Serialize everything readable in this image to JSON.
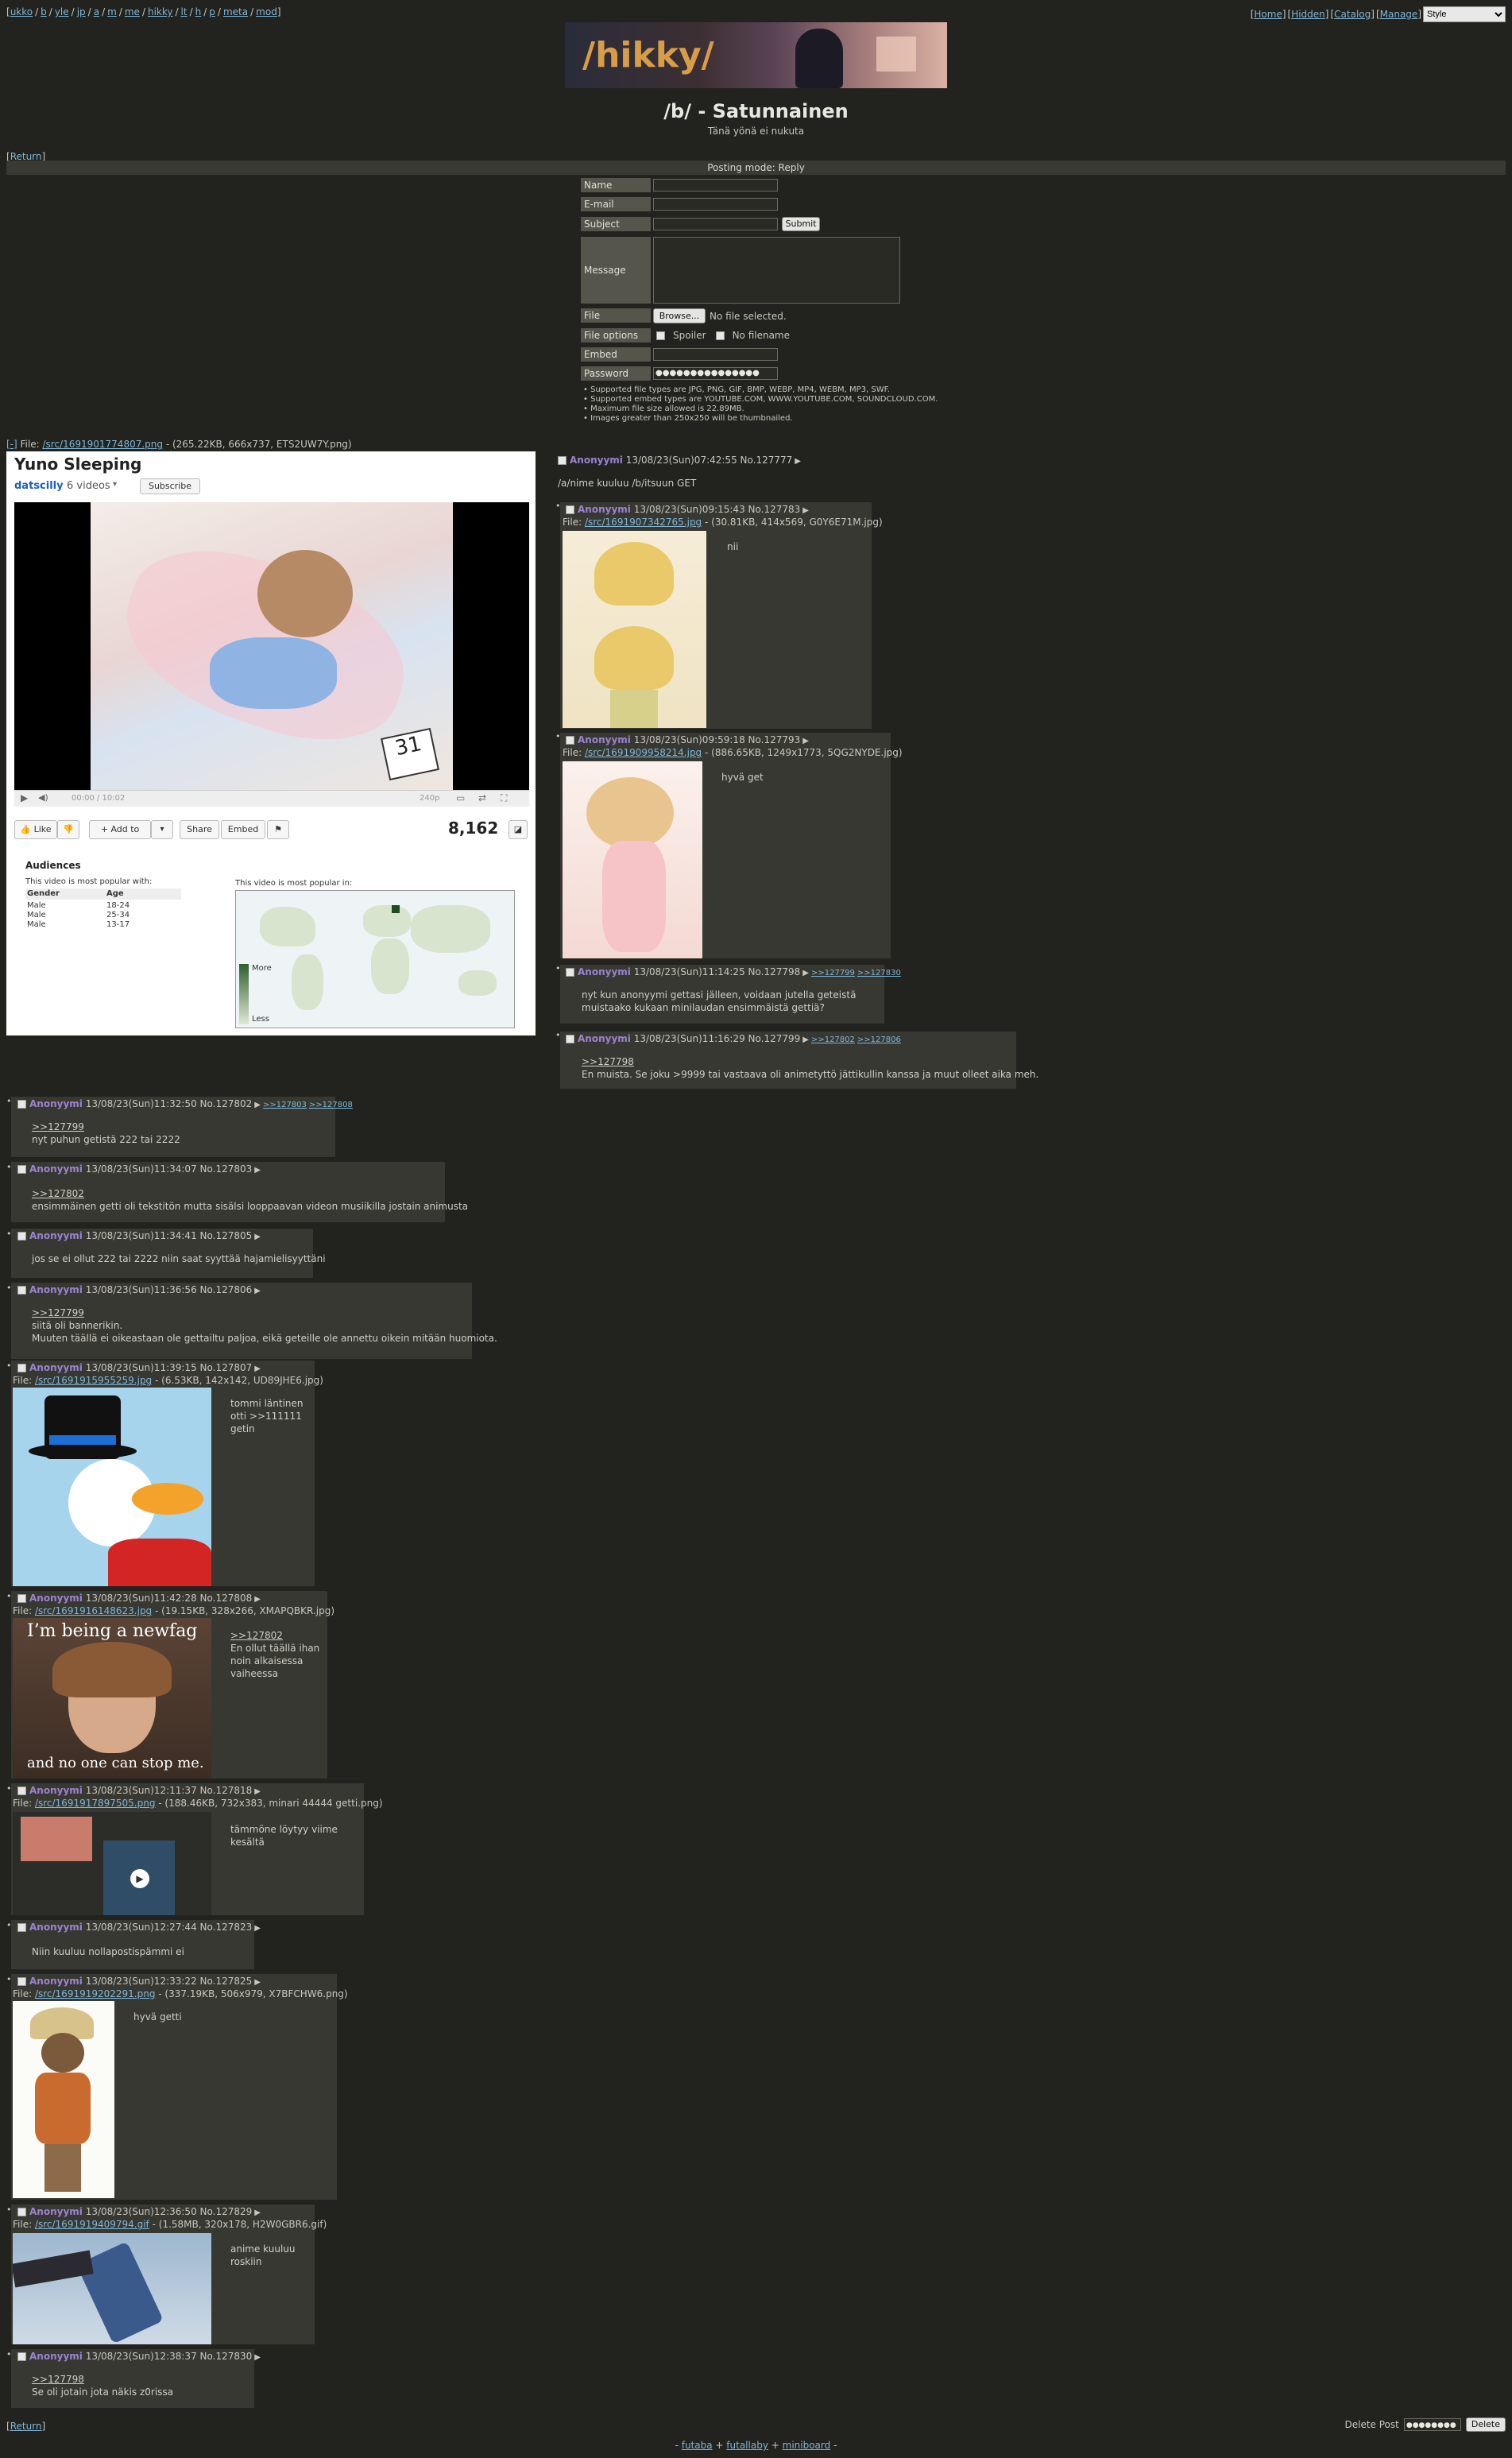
{
  "nav": {
    "boards": [
      "ukko",
      "b",
      "yle",
      "jp",
      "a",
      "m",
      "me",
      "hikky",
      "lt",
      "h",
      "p",
      "meta",
      "mod"
    ],
    "right_links": [
      "Home",
      "Hidden",
      "Catalog",
      "Manage"
    ],
    "style_select": "Style"
  },
  "banner": {
    "logo_text": "/hikky/"
  },
  "board": {
    "title": "/b/ - Satunnainen",
    "subtitle": "Tänä yönä ei nukuta"
  },
  "return_label": "Return",
  "posting_mode": "Posting mode: Reply",
  "form": {
    "name_label": "Name",
    "email_label": "E-mail",
    "subject_label": "Subject",
    "submit_label": "Submit",
    "message_label": "Message",
    "file_label": "File",
    "browse_label": "Browse...",
    "no_file": "No file selected.",
    "file_options_label": "File options",
    "spoiler_label": "Spoiler",
    "no_filename_label": "No filename",
    "embed_label": "Embed",
    "password_label": "Password",
    "password_value": "●●●●●●●●●●●●●●●"
  },
  "rules": [
    "Supported file types are JPG, PNG, GIF, BMP, WEBP, MP4, WEBM, MP3, SWF.",
    "Supported embed types are YOUTUBE.COM, WWW.YOUTUBE.COM, SOUNDCLOUD.COM.",
    "Maximum file size allowed is 22.89MB.",
    "Images greater than 250x250 will be thumbnailed."
  ],
  "op": {
    "collapse": "[-]",
    "file_prefix": "File:",
    "file_link": "/src/1691901774807.png",
    "file_meta": "- (265.22KB, 666x737, ETS2UW7Y.png)",
    "name": "Anonyymi",
    "date": "13/08/23(Sun)07:42:55",
    "no": "No.127777",
    "text": "/a/nime kuuluu /b/itsuun GET",
    "embed": {
      "title": "Yuno Sleeping",
      "channel": "datscilly",
      "videos": "6 videos",
      "subscribe": "Subscribe",
      "time": "00:00 / 10:02",
      "quality": "240p",
      "like": "Like",
      "add_to": "Add to",
      "share": "Share",
      "embed": "Embed",
      "views": "8,162",
      "audiences": "Audiences",
      "popular_with": "This video is most popular with:",
      "popular_in": "This video is most popular in:",
      "col_gender": "Gender",
      "col_age": "Age",
      "rows": [
        [
          "Male",
          "18-24"
        ],
        [
          "Male",
          "25-34"
        ],
        [
          "Male",
          "13-17"
        ]
      ],
      "legend_more": "More",
      "legend_less": "Less"
    }
  },
  "replies_right": [
    {
      "name": "Anonyymi",
      "date": "13/08/23(Sun)09:15:43",
      "no": "No.127783",
      "file_link": "/src/1691907342765.jpg",
      "file_meta": "- (30.81KB, 414x569, G0Y6E71M.jpg)",
      "text": "nii"
    },
    {
      "name": "Anonyymi",
      "date": "13/08/23(Sun)09:59:18",
      "no": "No.127793",
      "file_link": "/src/1691909958214.jpg",
      "file_meta": "- (886.65KB, 1249x1773, 5QG2NYDE.jpg)",
      "text": "hyvä get"
    },
    {
      "name": "Anonyymi",
      "date": "13/08/23(Sun)11:14:25",
      "no": "No.127798",
      "backlinks": [
        ">>127799",
        ">>127830"
      ],
      "text1": "nyt kun anonyymi gettasi jälleen, voidaan jutella geteistä",
      "text2": "muistaako kukaan minilaudan ensimmäistä gettiä?"
    },
    {
      "name": "Anonyymi",
      "date": "13/08/23(Sun)11:16:29",
      "no": "No.127799",
      "backlinks": [
        ">>127802",
        ">>127806"
      ],
      "quote": ">>127798",
      "text": "En muista. Se joku >9999 tai vastaava oli animetyttö jättikullin kanssa ja muut olleet aika meh."
    }
  ],
  "replies": [
    {
      "name": "Anonyymi",
      "date": "13/08/23(Sun)11:32:50",
      "no": "No.127802",
      "backlinks": [
        ">>127803",
        ">>127808"
      ],
      "quote": ">>127799",
      "text": "nyt puhun getistä 222 tai 2222"
    },
    {
      "name": "Anonyymi",
      "date": "13/08/23(Sun)11:34:07",
      "no": "No.127803",
      "quote": ">>127802",
      "text": "ensimmäinen getti oli tekstitön mutta sisälsi looppaavan videon musiikilla jostain animusta"
    },
    {
      "name": "Anonyymi",
      "date": "13/08/23(Sun)11:34:41",
      "no": "No.127805",
      "text": "jos se ei ollut 222 tai 2222 niin saat syyttää hajamielisyyttäni"
    },
    {
      "name": "Anonyymi",
      "date": "13/08/23(Sun)11:36:56",
      "no": "No.127806",
      "quote": ">>127799",
      "text1": "siitä oli bannerikin.",
      "text2": "Muuten täällä ei oikeastaan ole gettailtu paljoa, eikä geteille ole annettu oikein mitään huomiota."
    },
    {
      "name": "Anonyymi",
      "date": "13/08/23(Sun)11:39:15",
      "no": "No.127807",
      "file_link": "/src/1691915955259.jpg",
      "file_meta": "- (6.53KB, 142x142, UD89JHE6.jpg)",
      "text1": "tommi läntinen",
      "text2": "otti >>111111",
      "text3": "getin"
    },
    {
      "name": "Anonyymi",
      "date": "13/08/23(Sun)11:42:28",
      "no": "No.127808",
      "file_link": "/src/1691916148623.jpg",
      "file_meta": "- (19.15KB, 328x266, XMAPQBKR.jpg)",
      "quote": ">>127802",
      "text1": "En ollut täällä ihan",
      "text2": "noin alkaisessa",
      "text3": "vaiheessa",
      "img_top": "I’m being a newfag",
      "img_bottom": "and no one can stop me."
    },
    {
      "name": "Anonyymi",
      "date": "13/08/23(Sun)12:11:37",
      "no": "No.127818",
      "file_link": "/src/1691917897505.png",
      "file_meta": "- (188.46KB, 732x383, minari 44444 getti.png)",
      "text1": "tämmöne löytyy viime",
      "text2": "kesältä"
    },
    {
      "name": "Anonyymi",
      "date": "13/08/23(Sun)12:27:44",
      "no": "No.127823",
      "text": "Niin kuuluu nollapostispämmi ei"
    },
    {
      "name": "Anonyymi",
      "date": "13/08/23(Sun)12:33:22",
      "no": "No.127825",
      "file_link": "/src/1691919202291.png",
      "file_meta": "- (337.19KB, 506x979, X7BFCHW6.png)",
      "text": "hyvä getti"
    },
    {
      "name": "Anonyymi",
      "date": "13/08/23(Sun)12:36:50",
      "no": "No.127829",
      "file_link": "/src/1691919409794.gif",
      "file_meta": "- (1.58MB, 320x178, H2W0GBR6.gif)",
      "text1": "anime kuuluu",
      "text2": "roskiin"
    },
    {
      "name": "Anonyymi",
      "date": "13/08/23(Sun)12:38:37",
      "no": "No.127830",
      "quote": ">>127798",
      "text": "Se oli jotain jota näkis z0rissa"
    }
  ],
  "bottom": {
    "delete_post": "Delete Post",
    "delete_password": "●●●●●●●●",
    "delete_button": "Delete",
    "footer_links": [
      "futaba",
      "futallaby",
      "miniboard"
    ]
  },
  "colors": {
    "bg": "#22221e",
    "post_bg": "#383832",
    "name": "#9b83d0",
    "link": "#7fb7d8"
  }
}
